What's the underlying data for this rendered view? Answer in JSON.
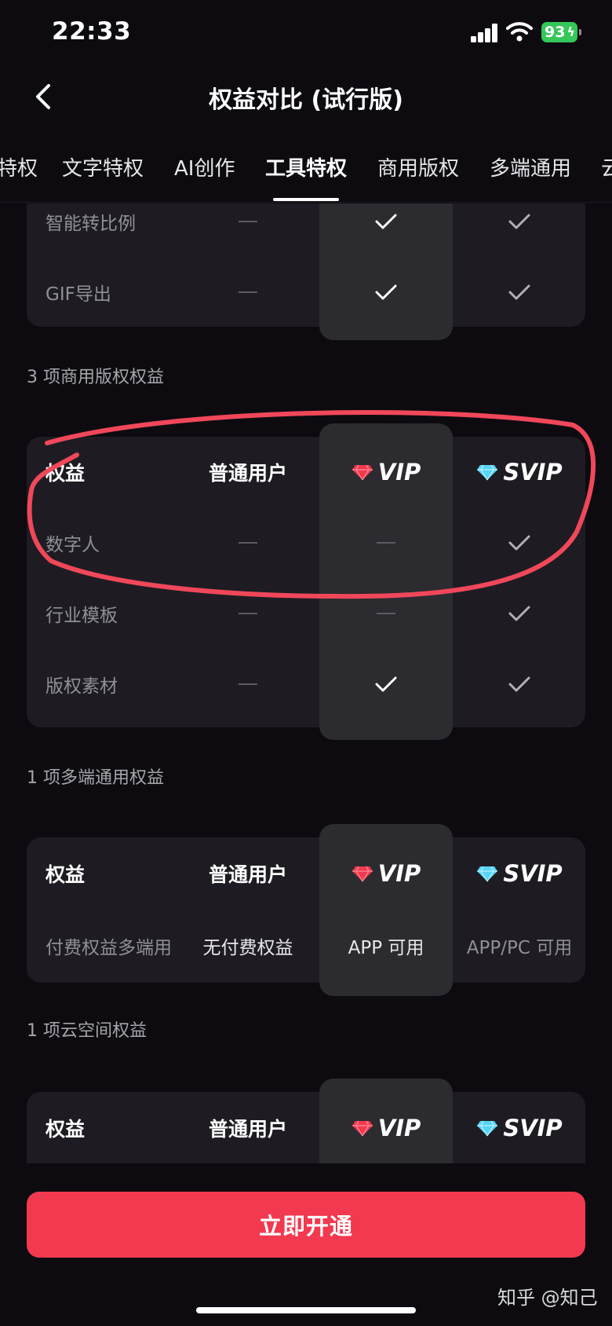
{
  "status_bar": {
    "time": "22:33",
    "battery": "93"
  },
  "nav": {
    "title": "权益对比 (试行版)"
  },
  "tabs": [
    {
      "label": "特权"
    },
    {
      "label": "文字特权"
    },
    {
      "label": "AI创作"
    },
    {
      "label": "工具特权",
      "active": true
    },
    {
      "label": "商用版权"
    },
    {
      "label": "多端通用"
    },
    {
      "label": "云"
    }
  ],
  "header_labels": {
    "benefit": "权益",
    "normal": "普通用户",
    "vip": "VIP",
    "svip": "SVIP"
  },
  "tool_section": {
    "rows": [
      {
        "name": "智能转比例",
        "normal": "none",
        "vip": "check",
        "svip": "check"
      },
      {
        "name": "GIF导出",
        "normal": "none",
        "vip": "check",
        "svip": "check"
      }
    ]
  },
  "commercial_section": {
    "title": "3 项商用版权权益",
    "rows": [
      {
        "name": "数字人",
        "normal": "none",
        "vip": "none",
        "svip": "check"
      },
      {
        "name": "行业模板",
        "normal": "none",
        "vip": "none",
        "svip": "check"
      },
      {
        "name": "版权素材",
        "normal": "none",
        "vip": "check",
        "svip": "check"
      }
    ]
  },
  "multi_section": {
    "title": "1 项多端通用权益",
    "rows": [
      {
        "name": "付费权益多端用",
        "normal": "无付费权益",
        "vip": "APP 可用",
        "svip": "APP/PC 可用"
      }
    ]
  },
  "cloud_section": {
    "title": "1 项云空间权益"
  },
  "cta": {
    "label": "立即开通"
  },
  "watermark": "知乎 @知己",
  "colors": {
    "accent": "#f2394f",
    "card_bg": "#1e1c22",
    "vip_column_bg": "#2c2b30",
    "page_bg": "#0d0b10",
    "annotation_red": "#f0475a"
  }
}
